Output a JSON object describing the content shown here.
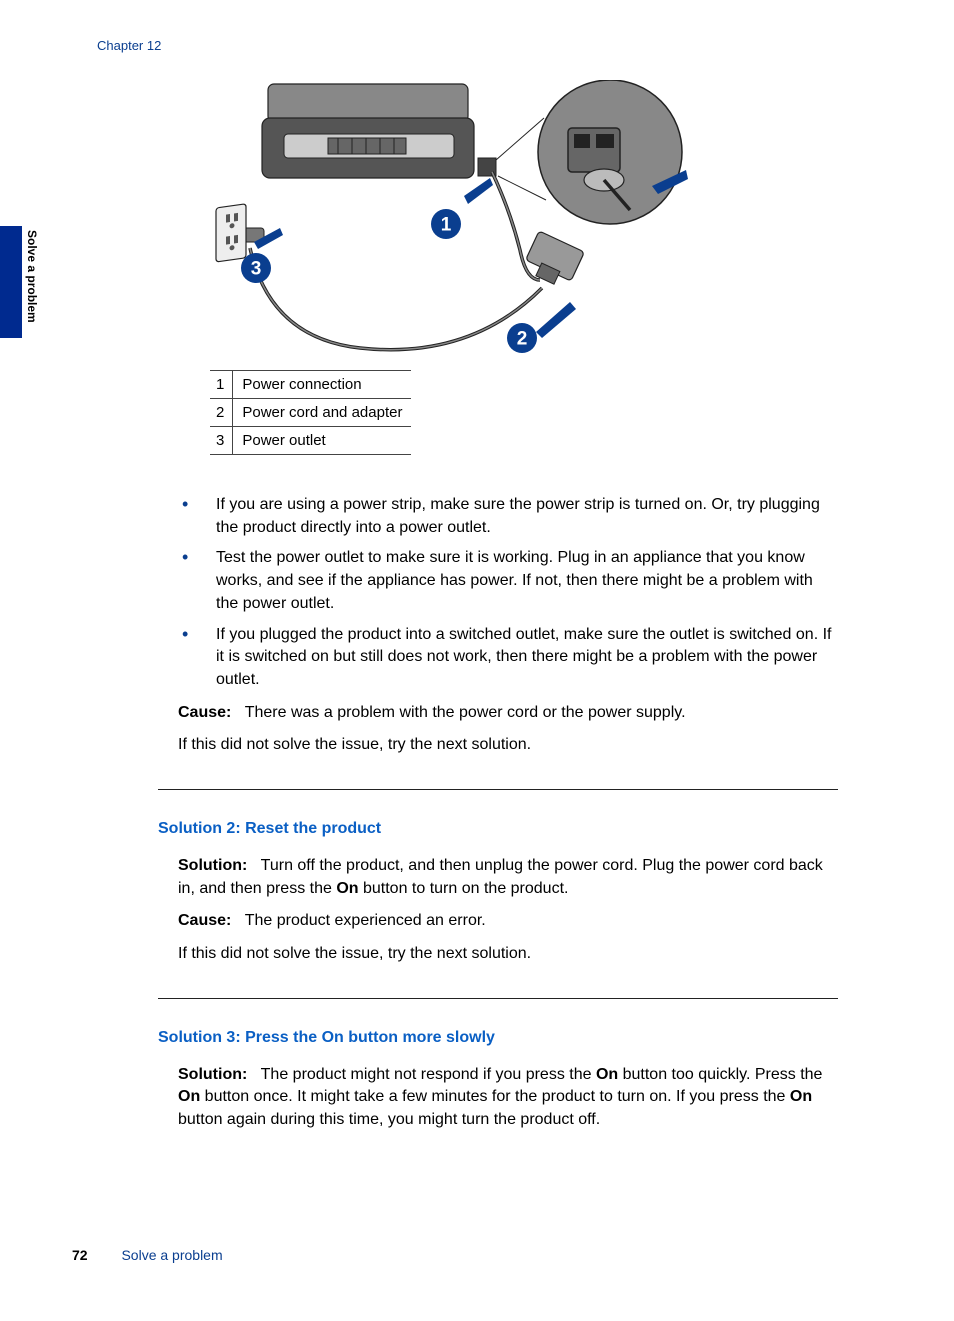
{
  "chapter": "Chapter 12",
  "side_tab": "Solve a problem",
  "legend": {
    "r1n": "1",
    "r1t": "Power connection",
    "r2n": "2",
    "r2t": "Power cord and adapter",
    "r3n": "3",
    "r3t": "Power outlet"
  },
  "bullets": {
    "b1": "If you are using a power strip, make sure the power strip is turned on. Or, try plugging the product directly into a power outlet.",
    "b2": "Test the power outlet to make sure it is working. Plug in an appliance that you know works, and see if the appliance has power. If not, then there might be a problem with the power outlet.",
    "b3": "If you plugged the product into a switched outlet, make sure the outlet is switched on. If it is switched on but still does not work, then there might be a problem with the power outlet."
  },
  "cause_label": "Cause:",
  "cause1": "There was a problem with the power cord or the power supply.",
  "try_next": "If this did not solve the issue, try the next solution.",
  "sol2_heading": "Solution 2: Reset the product",
  "sol_label": "Solution:",
  "sol2_text_a": "Turn off the product, and then unplug the power cord. Plug the power cord back in, and then press the ",
  "on_word": "On",
  "sol2_text_b": " button to turn on the product.",
  "cause2": "The product experienced an error.",
  "sol3_heading_a": "Solution 3: Press the ",
  "sol3_heading_b": " button more slowly",
  "sol3_text_a": "The product might not respond if you press the ",
  "sol3_text_b": " button too quickly. Press the ",
  "sol3_text_c": " button once. It might take a few minutes for the product to turn on. If you press the ",
  "sol3_text_d": " button again during this time, you might turn the product off.",
  "page_number": "72",
  "footer_title": "Solve a problem",
  "callouts": {
    "c1": "1",
    "c2": "2",
    "c3": "3"
  }
}
